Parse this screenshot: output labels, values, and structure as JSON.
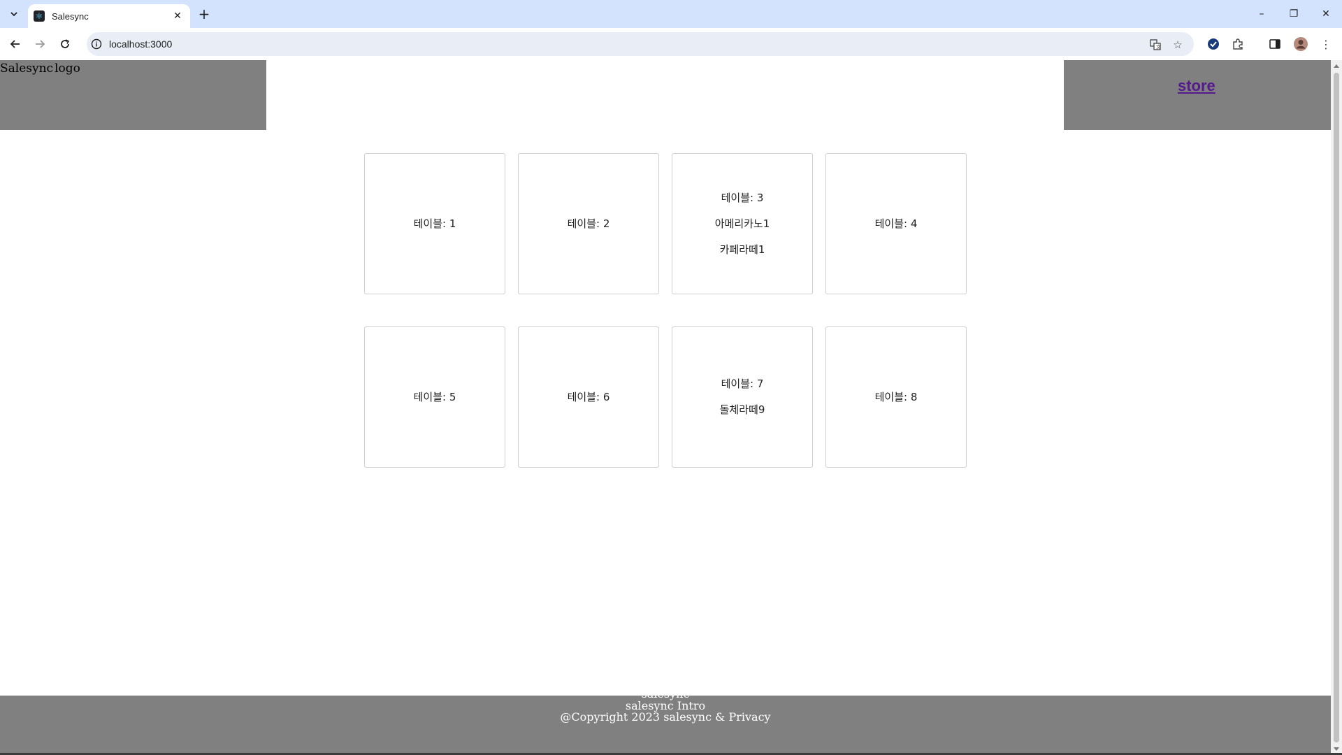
{
  "browser": {
    "tab_title": "Salesync",
    "url": "localhost:3000",
    "window_controls": {
      "minimize": "–",
      "restore": "❐",
      "close": "✕"
    }
  },
  "header": {
    "brand_text": "Salesync",
    "logo_alt": "logo",
    "nav_link": "store"
  },
  "tables": [
    {
      "label": "테이블: 1",
      "orders": []
    },
    {
      "label": "테이블: 2",
      "orders": []
    },
    {
      "label": "테이블: 3",
      "orders": [
        "아메리카노1",
        "카페라떼1"
      ]
    },
    {
      "label": "테이블: 4",
      "orders": []
    },
    {
      "label": "테이블: 5",
      "orders": []
    },
    {
      "label": "테이블: 6",
      "orders": []
    },
    {
      "label": "테이블: 7",
      "orders": [
        "돌체라떼9"
      ]
    },
    {
      "label": "테이블: 8",
      "orders": []
    }
  ],
  "footer": {
    "line1": "salesync",
    "line2": "salesync Intro",
    "line3": "@Copyright 2023 salesync & Privacy"
  }
}
